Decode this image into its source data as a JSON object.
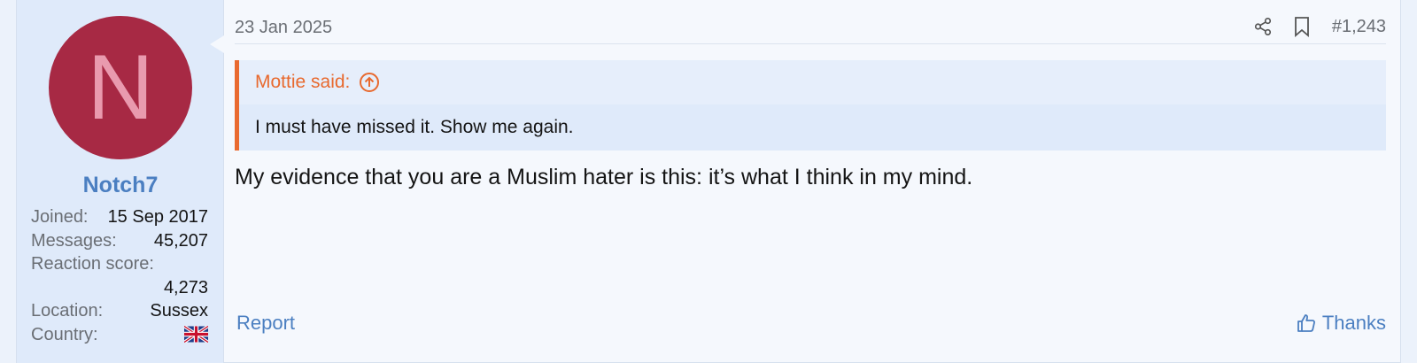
{
  "user": {
    "avatar_letter": "N",
    "name": "Notch7",
    "stats": {
      "joined_label": "Joined:",
      "joined_value": "15 Sep 2017",
      "messages_label": "Messages:",
      "messages_value": "45,207",
      "reaction_label": "Reaction score:",
      "reaction_value": "4,273",
      "location_label": "Location:",
      "location_value": "Sussex",
      "country_label": "Country:",
      "country_flag": "uk-flag-icon"
    }
  },
  "post": {
    "date": "23 Jan 2025",
    "number": "#1,243",
    "icons": [
      "share-icon",
      "bookmark-icon"
    ],
    "quote": {
      "author": "Mottie said:",
      "text": "I must have missed it. Show me again."
    },
    "message": "My evidence that you are a Muslim hater is this: it’s what I think in my mind.",
    "report_label": "Report",
    "thanks_label": "Thanks"
  },
  "colors": {
    "accent": "#4b7fc1",
    "quote_accent": "#e96a30",
    "avatar_bg": "#a72944",
    "sidebar_bg": "#dfeafa"
  }
}
